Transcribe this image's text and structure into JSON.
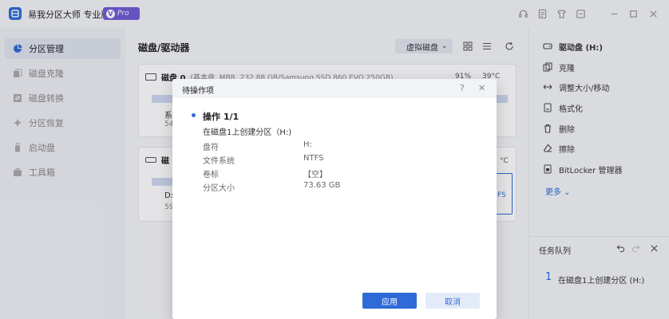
{
  "app": {
    "title": "易我分区大师 专业版",
    "badge_v": "V",
    "badge": "Pro"
  },
  "sidebar": {
    "items": [
      {
        "label": "分区管理",
        "icon": "pie-chart-icon"
      },
      {
        "label": "磁盘克隆",
        "icon": "clone-icon"
      },
      {
        "label": "磁盘转换",
        "icon": "convert-icon"
      },
      {
        "label": "分区恢复",
        "icon": "recover-icon"
      },
      {
        "label": "启动盘",
        "icon": "usb-icon"
      },
      {
        "label": "工具箱",
        "icon": "toolbox-icon"
      }
    ]
  },
  "main": {
    "title": "磁盘/驱动器",
    "view_select": "虚拟磁盘",
    "disk0": {
      "name": "磁盘 0",
      "info": "(基本盘, MBR, 232.88 GB/Samsung SSD 860 EVO 250GB)",
      "health": "91%",
      "temp": "39°C",
      "part_label": "系",
      "part_size": "549"
    },
    "disk1": {
      "name": "磁",
      "temp_suffix": "°C",
      "part_label": "D:",
      "part_size": "593",
      "part_fs_suffix": "FS"
    }
  },
  "right": {
    "drive": "驱动盘 (H:)",
    "actions": [
      "克隆",
      "调整大小/移动",
      "格式化",
      "删除",
      "擦除",
      "BitLocker 管理器"
    ],
    "more": "更多 ⌄",
    "queue_title": "任务队列",
    "queue_index": "1",
    "queue_item": "在磁盘1上创建分区 (H:)"
  },
  "modal": {
    "title": "待操作项",
    "help": "?",
    "close": "✕",
    "op_title": "操作 1/1",
    "op_desc": "在磁盘1上创建分区（H:)",
    "props": [
      {
        "label": "盘符",
        "value": "H:"
      },
      {
        "label": "文件系统",
        "value": "NTFS"
      },
      {
        "label": "卷标",
        "value": "【空】"
      },
      {
        "label": "分区大小",
        "value": "73.63 GB"
      }
    ],
    "apply": "应用",
    "cancel": "取消"
  }
}
